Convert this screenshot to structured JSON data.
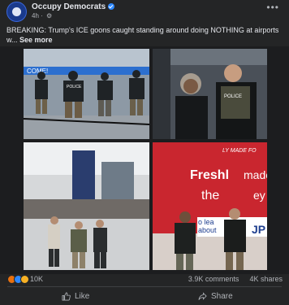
{
  "post": {
    "page_name": "Occupy Democrats",
    "time": "4h",
    "more_icon": "more-horizontal-icon",
    "text": "BREAKING: Trump's ICE goons caught standing around doing NOTHING at airports w...",
    "see_more": "See more"
  },
  "media": {
    "photos": [
      {
        "signs": [
          "COME!",
          "POLICE"
        ]
      },
      {
        "signs": [
          "POLICE"
        ]
      },
      {
        "signs": []
      },
      {
        "signs": [
          "LY MADE FO",
          "Freshl",
          "made",
          "the",
          "ey",
          "o lea",
          "about",
          "JP"
        ]
      }
    ]
  },
  "engagement": {
    "reaction_count": "10K",
    "reactions": [
      "angry",
      "like",
      "wow"
    ],
    "comments": "3.9K comments",
    "shares": "4K shares"
  },
  "actions": {
    "like_label": "Like",
    "share_label": "Share"
  },
  "colors": {
    "background": "#242526",
    "text": "#e4e6eb",
    "muted": "#b0b3b8",
    "verified": "#2d88ff"
  }
}
